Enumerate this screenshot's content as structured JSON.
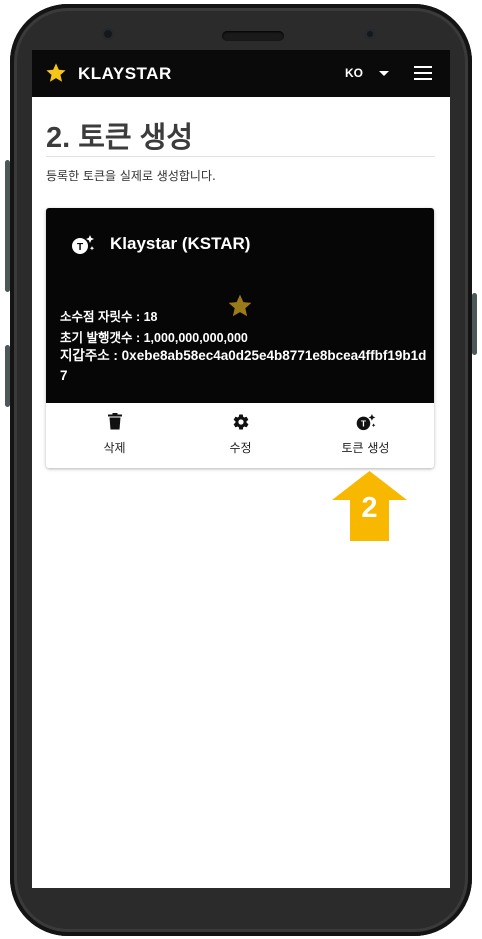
{
  "appbar": {
    "brand": "KLAYSTAR",
    "language": "KO",
    "logo_icon": "star-icon",
    "menu_icon": "hamburger-menu-icon"
  },
  "page": {
    "title": "2. 토큰 생성",
    "subtitle": "등록한 토큰을 실제로 생성합니다."
  },
  "token_card": {
    "name": "Klaystar (KSTAR)",
    "decimals_line": "소수점 자릿수 : 18",
    "supply_line": "초기 발행갯수 : 1,000,000,000,000",
    "address_line": "지갑주소 : 0xebe8ab58ec4a0d25e4b8771e8bcea4ffbf19b1d7",
    "actions": [
      {
        "label": "삭제",
        "icon": "trash-icon"
      },
      {
        "label": "수정",
        "icon": "gear-icon"
      },
      {
        "label": "토큰 생성",
        "icon": "token-create-icon"
      }
    ]
  },
  "annotation": {
    "step_number": "2"
  },
  "colors": {
    "accent_star": "#f5c518",
    "card_star": "#9a7a1a",
    "arrow": "#f9b800",
    "appbar_bg": "#0a0a0a"
  }
}
